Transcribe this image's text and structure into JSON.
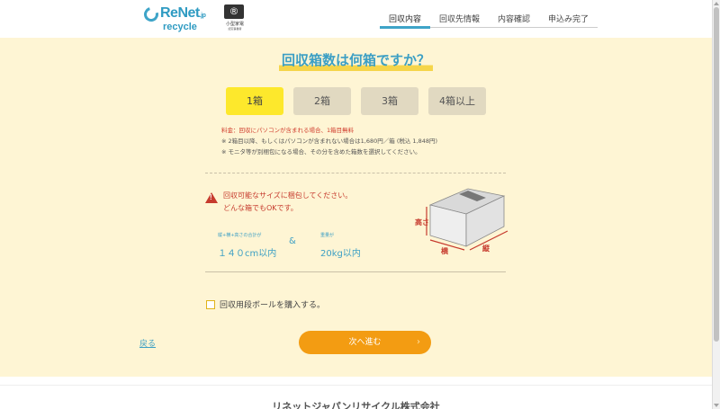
{
  "header": {
    "logo_brand": "ReNet",
    "logo_suffix": ".jp",
    "logo_sub": "recycle",
    "partner_mark": "®",
    "partner_name": "小型家電",
    "partner_caption": "認定事業者",
    "steps": [
      {
        "label": "回収内容",
        "active": true
      },
      {
        "label": "回収先情報",
        "active": false
      },
      {
        "label": "内容確認",
        "active": false
      },
      {
        "label": "申込み完了",
        "active": false
      }
    ]
  },
  "main": {
    "title": "回収箱数は何箱ですか？",
    "box_options": [
      {
        "label": "1箱",
        "selected": true
      },
      {
        "label": "2箱",
        "selected": false
      },
      {
        "label": "3箱",
        "selected": false
      },
      {
        "label": "4箱以上",
        "selected": false
      }
    ],
    "notes": {
      "fee": "料金：回収にパソコンが含まれる場合、1箱目無料",
      "note1": "※ 2箱目以降、もしくはパソコンが含まれない場合は1,680円／箱 (税込 1,848円)",
      "note2": "※ モニタ等が別梱包になる場合、その分を含めた箱数を選択してください。"
    },
    "warning": {
      "line1": "回収可能なサイズに梱包してください。",
      "line2": "どんな箱でもOKです。"
    },
    "size": {
      "dims_label": "縦+横+高さの合計が",
      "dims_value": "１４０cm以内",
      "amp": "&",
      "weight_label": "重量が",
      "weight_value": "20kg以内"
    },
    "diagram": {
      "height": "高さ",
      "width": "横",
      "depth": "縦"
    },
    "checkbox_label": "回収用段ボールを購入する。",
    "back_label": "戻る",
    "next_label": "次へ進む",
    "next_chevron": "›"
  },
  "footer": {
    "company": "リネットジャパンリサイクル株式会社"
  },
  "colors": {
    "accent": "#3ea4c8",
    "panel": "#fef5d4",
    "selected": "#fde82c",
    "next_button": "#f39c12",
    "warning": "#c63a2d"
  }
}
